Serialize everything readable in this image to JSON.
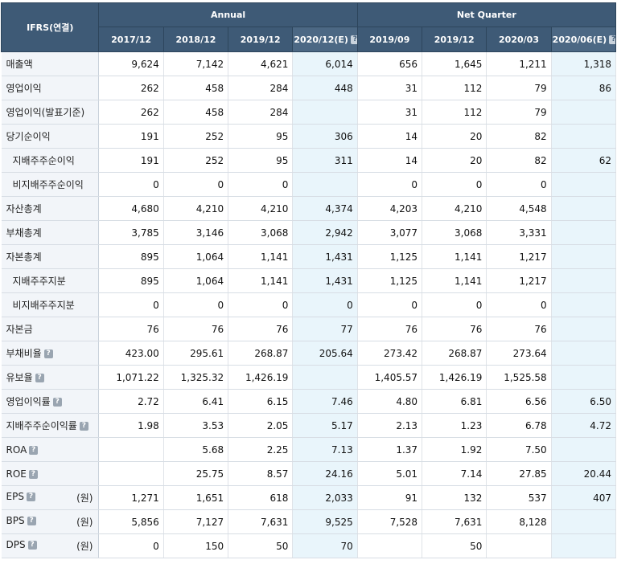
{
  "header": {
    "title": "IFRS(연결)",
    "annual_label": "Annual",
    "quarter_label": "Net Quarter",
    "columns": [
      "2017/12",
      "2018/12",
      "2019/12",
      "2020/12(E)",
      "2019/09",
      "2019/12",
      "2020/03",
      "2020/06(E)"
    ],
    "estimate_columns": [
      3,
      7
    ],
    "help_columns": [
      3,
      7
    ]
  },
  "unit_label": "(원)",
  "rows": [
    {
      "label": "매출액",
      "indent": false,
      "help": false,
      "unit": false,
      "values": [
        "9,624",
        "7,142",
        "4,621",
        "6,014",
        "656",
        "1,645",
        "1,211",
        "1,318"
      ]
    },
    {
      "label": "영업이익",
      "indent": false,
      "help": false,
      "unit": false,
      "values": [
        "262",
        "458",
        "284",
        "448",
        "31",
        "112",
        "79",
        "86"
      ]
    },
    {
      "label": "영업이익(발표기준)",
      "indent": false,
      "help": false,
      "unit": false,
      "values": [
        "262",
        "458",
        "284",
        "",
        "31",
        "112",
        "79",
        ""
      ]
    },
    {
      "label": "당기순이익",
      "indent": false,
      "help": false,
      "unit": false,
      "values": [
        "191",
        "252",
        "95",
        "306",
        "14",
        "20",
        "82",
        ""
      ]
    },
    {
      "label": "지배주주순이익",
      "indent": true,
      "help": false,
      "unit": false,
      "values": [
        "191",
        "252",
        "95",
        "311",
        "14",
        "20",
        "82",
        "62"
      ]
    },
    {
      "label": "비지배주주순이익",
      "indent": true,
      "help": false,
      "unit": false,
      "values": [
        "0",
        "0",
        "0",
        "",
        "0",
        "0",
        "0",
        ""
      ]
    },
    {
      "label": "자산총계",
      "indent": false,
      "help": false,
      "unit": false,
      "values": [
        "4,680",
        "4,210",
        "4,210",
        "4,374",
        "4,203",
        "4,210",
        "4,548",
        ""
      ]
    },
    {
      "label": "부채총계",
      "indent": false,
      "help": false,
      "unit": false,
      "values": [
        "3,785",
        "3,146",
        "3,068",
        "2,942",
        "3,077",
        "3,068",
        "3,331",
        ""
      ]
    },
    {
      "label": "자본총계",
      "indent": false,
      "help": false,
      "unit": false,
      "values": [
        "895",
        "1,064",
        "1,141",
        "1,431",
        "1,125",
        "1,141",
        "1,217",
        ""
      ]
    },
    {
      "label": "지배주주지분",
      "indent": true,
      "help": false,
      "unit": false,
      "values": [
        "895",
        "1,064",
        "1,141",
        "1,431",
        "1,125",
        "1,141",
        "1,217",
        ""
      ]
    },
    {
      "label": "비지배주주지분",
      "indent": true,
      "help": false,
      "unit": false,
      "values": [
        "0",
        "0",
        "0",
        "0",
        "0",
        "0",
        "0",
        ""
      ]
    },
    {
      "label": "자본금",
      "indent": false,
      "help": false,
      "unit": false,
      "values": [
        "76",
        "76",
        "76",
        "77",
        "76",
        "76",
        "76",
        ""
      ]
    },
    {
      "label": "부채비율",
      "indent": false,
      "help": true,
      "unit": false,
      "values": [
        "423.00",
        "295.61",
        "268.87",
        "205.64",
        "273.42",
        "268.87",
        "273.64",
        ""
      ]
    },
    {
      "label": "유보율",
      "indent": false,
      "help": true,
      "unit": false,
      "values": [
        "1,071.22",
        "1,325.32",
        "1,426.19",
        "",
        "1,405.57",
        "1,426.19",
        "1,525.58",
        ""
      ]
    },
    {
      "label": "영업이익률",
      "indent": false,
      "help": true,
      "unit": false,
      "values": [
        "2.72",
        "6.41",
        "6.15",
        "7.46",
        "4.80",
        "6.81",
        "6.56",
        "6.50"
      ]
    },
    {
      "label": "지배주주순이익률",
      "indent": false,
      "help": true,
      "unit": false,
      "values": [
        "1.98",
        "3.53",
        "2.05",
        "5.17",
        "2.13",
        "1.23",
        "6.78",
        "4.72"
      ]
    },
    {
      "label": "ROA",
      "indent": false,
      "help": true,
      "unit": false,
      "values": [
        "",
        "5.68",
        "2.25",
        "7.13",
        "1.37",
        "1.92",
        "7.50",
        ""
      ]
    },
    {
      "label": "ROE",
      "indent": false,
      "help": true,
      "unit": false,
      "values": [
        "",
        "25.75",
        "8.57",
        "24.16",
        "5.01",
        "7.14",
        "27.85",
        "20.44"
      ]
    },
    {
      "label": "EPS",
      "indent": false,
      "help": true,
      "unit": true,
      "values": [
        "1,271",
        "1,651",
        "618",
        "2,033",
        "91",
        "132",
        "537",
        "407"
      ]
    },
    {
      "label": "BPS",
      "indent": false,
      "help": true,
      "unit": true,
      "values": [
        "5,856",
        "7,127",
        "7,631",
        "9,525",
        "7,528",
        "7,631",
        "8,128",
        ""
      ]
    },
    {
      "label": "DPS",
      "indent": false,
      "help": true,
      "unit": true,
      "values": [
        "0",
        "150",
        "50",
        "70",
        "",
        "50",
        "",
        ""
      ]
    }
  ],
  "icons": {
    "help": "help-icon"
  }
}
